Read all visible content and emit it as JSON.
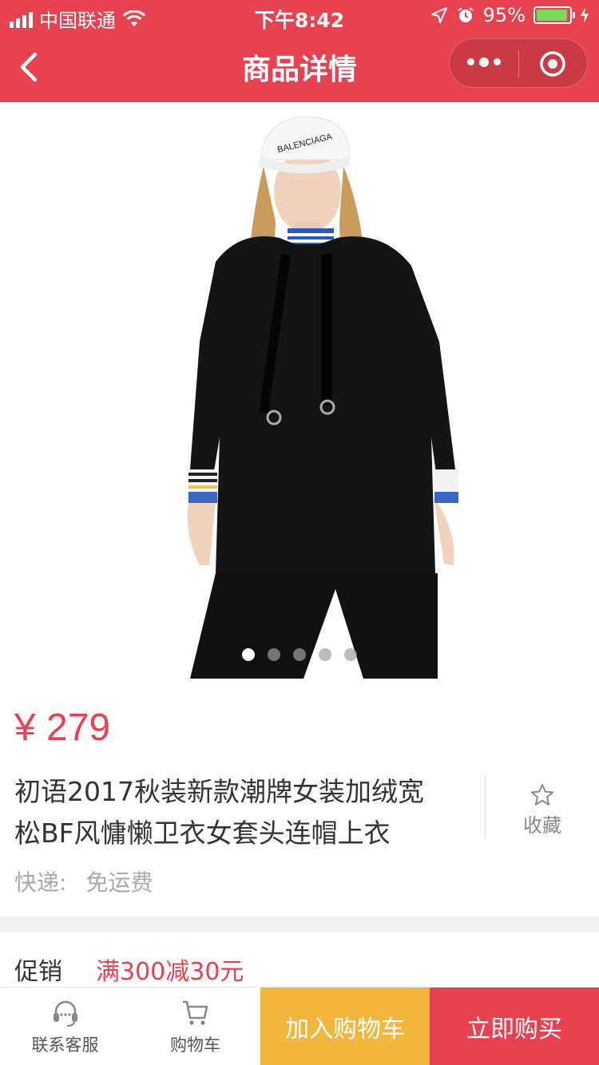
{
  "status_bar": {
    "carrier": "中国联通",
    "time": "下午8:42",
    "battery_percent": "95%",
    "battery_level": 0.95
  },
  "nav": {
    "title": "商品详情",
    "back_icon": "chevron-left-icon",
    "more_icon": "more-dots-icon",
    "close_icon": "target-circle-icon"
  },
  "product": {
    "image_icon": "product-photo",
    "carousel_total": 5,
    "carousel_active": 1,
    "price": "¥ 279",
    "title_line1": "初语2017秋装新款潮牌女装加绒宽",
    "title_line2": "松BF风慵懒卫衣女套头连帽上衣",
    "favorite_label": "收藏",
    "shipping_key": "快递:",
    "shipping_value": "免运费"
  },
  "promotion": {
    "key": "促销",
    "value": "满300减30元"
  },
  "bottom_bar": {
    "customer_service": "联系客服",
    "cart": "购物车",
    "add_to_cart": "加入购物车",
    "buy_now": "立即购买"
  },
  "colors": {
    "brand_red": "#e8414f",
    "add_cart_yellow": "#f2b63d",
    "battery_green": "#7ed957"
  }
}
